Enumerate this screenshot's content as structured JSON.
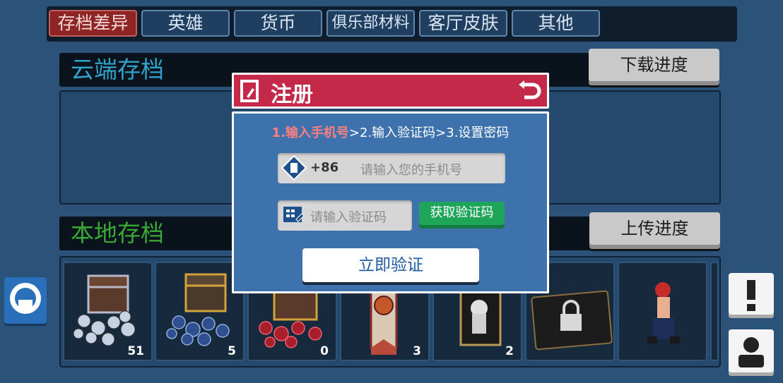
{
  "tabs": [
    {
      "label": "存档差异",
      "active": true
    },
    {
      "label": "英雄",
      "active": false
    },
    {
      "label": "货币",
      "active": false
    },
    {
      "label": "俱乐部材料",
      "active": false
    },
    {
      "label": "客厅皮肤",
      "active": false
    },
    {
      "label": "其他",
      "active": false
    }
  ],
  "cloud": {
    "title": "云端存档",
    "button": "下载进度",
    "title_color": "#2fa3c9"
  },
  "local": {
    "title": "本地存档",
    "button": "上传进度",
    "title_color": "#3aa834"
  },
  "items": [
    {
      "icon": "silver-gem-chest-icon",
      "count": "51"
    },
    {
      "icon": "blue-gem-chest-icon",
      "count": "5"
    },
    {
      "icon": "red-gem-chest-icon",
      "count": "0"
    },
    {
      "icon": "ribbon-badge-icon",
      "count": "3"
    },
    {
      "icon": "tarot-card-icon",
      "count": "2"
    },
    {
      "icon": "locked-card-icon",
      "count": ""
    },
    {
      "icon": "hero-character-icon",
      "count": ""
    }
  ],
  "modal": {
    "title": "注册",
    "step1": "1.输入手机号",
    "step_rest": ">2.输入验证码>3.设置密码",
    "country_code": "+86",
    "phone_placeholder": "请输入您的手机号",
    "code_placeholder": "请输入验证码",
    "get_code": "获取验证码",
    "verify": "立即验证"
  },
  "colors": {
    "accent_red": "#c4294a",
    "modal_blue": "#3d72ad",
    "green": "#1fa55a"
  }
}
